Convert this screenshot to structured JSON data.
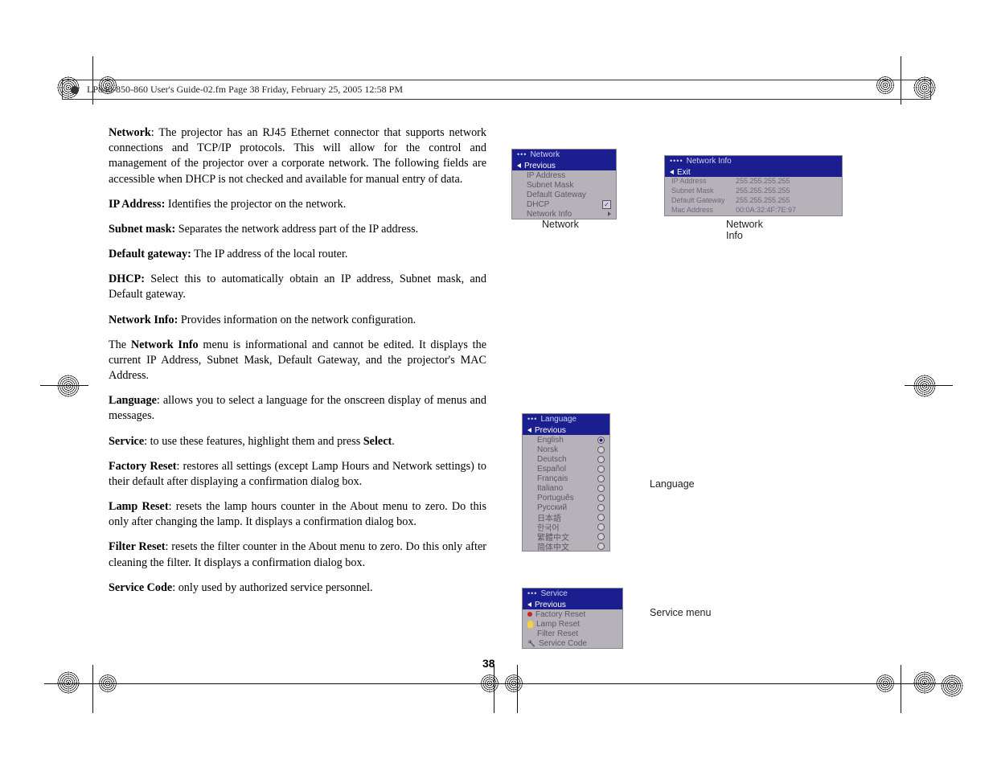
{
  "header": {
    "text": "LP840-850-860 User's Guide-02.fm  Page 38  Friday, February 25, 2005  12:58 PM"
  },
  "body": {
    "p1_prefix": "Network",
    "p1": ": The projector has an RJ45 Ethernet connector that supports network connections and TCP/IP protocols. This will allow for the control and management of the projector over a corporate network. The following fields are accessible when DHCP is not checked and available for manual entry of data.",
    "ip_label": "IP Address:",
    "ip_text": " Identifies the projector on the network.",
    "subnet_label": "Subnet mask:",
    "subnet_text": " Separates the network address part of the IP address.",
    "gateway_label": "Default gateway:",
    "gateway_text": " The IP address of the local router.",
    "dhcp_label": "DHCP:",
    "dhcp_text": " Select this to automatically obtain an IP address, Subnet mask, and Default gateway.",
    "ninfo_label": "Network Info:",
    "ninfo_text": " Provides information on the network configuration.",
    "p2a": "The ",
    "p2b": "Network Info",
    "p2c": " menu is informational and cannot be edited. It displays the current IP Address, Subnet Mask, Default Gateway, and the projector's MAC Address.",
    "lang_label": "Language",
    "lang_text": ": allows you to select a language for the onscreen display of menus and messages.",
    "svc_label": "Service",
    "svc_text_a": ": to use these features, highlight them and press ",
    "svc_text_b": "Select",
    "svc_text_c": ".",
    "factory_label": "Factory Reset",
    "factory_text": ": restores all settings (except Lamp Hours and Network settings) to their default after displaying a confirmation dialog box.",
    "lamp_label": "Lamp Reset",
    "lamp_text": ": resets the lamp hours counter in the About menu to zero. Do this only after changing the lamp. It displays a confirmation dialog box.",
    "filter_label": "Filter Reset",
    "filter_text": ": resets the filter counter in the About menu to zero. Do this only after cleaning the filter. It displays a confirmation dialog box.",
    "code_label": "Service Code",
    "code_text": ": only used by authorized service personnel."
  },
  "page_number": "38",
  "captions": {
    "network": "Network",
    "network_info": "Network Info",
    "language": "Language",
    "service": "Service menu"
  },
  "osd": {
    "network": {
      "title": "Network",
      "items": [
        "Previous",
        "IP Address",
        "Subnet Mask",
        "Default Gateway",
        "DHCP",
        "Network Info"
      ]
    },
    "network_info": {
      "title": "Network Info",
      "exit": "Exit",
      "rows": [
        {
          "k": "IP Address",
          "v": "255.255.255.255"
        },
        {
          "k": "Subnet Mask",
          "v": "255.255.255.255"
        },
        {
          "k": "Default Gateway",
          "v": "255.255.255.255"
        },
        {
          "k": "Mac Address",
          "v": "00:0A:32:4F:7E:97"
        }
      ]
    },
    "language": {
      "title": "Language",
      "items": [
        "Previous",
        "English",
        "Norsk",
        "Deutsch",
        "Español",
        "Français",
        "Italiano",
        "Português",
        "Русский",
        "日本語",
        "한국어",
        "繁體中文",
        "简体中文"
      ]
    },
    "service": {
      "title": "Service",
      "items": [
        "Previous",
        "Factory Reset",
        "Lamp Reset",
        "Filter Reset",
        "Service Code"
      ]
    }
  }
}
